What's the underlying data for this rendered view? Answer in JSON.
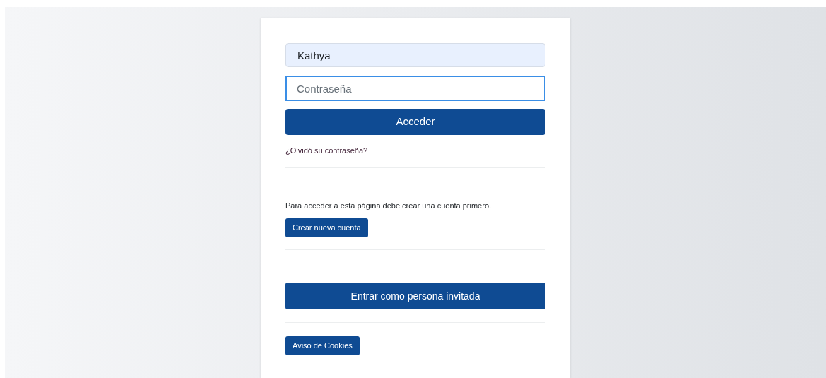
{
  "login_form": {
    "username": {
      "value": "Kathya"
    },
    "password": {
      "placeholder": "Contraseña",
      "focused": true
    },
    "submit_button": "Acceder",
    "forgot_link": "¿Olvidó su contraseña?"
  },
  "signup": {
    "message": "Para acceder a esta página debe crear una cuenta primero.",
    "button": "Crear nueva cuenta"
  },
  "guest_button": "Entrar como persona invitada",
  "cookies_button": "Aviso de Cookies"
}
